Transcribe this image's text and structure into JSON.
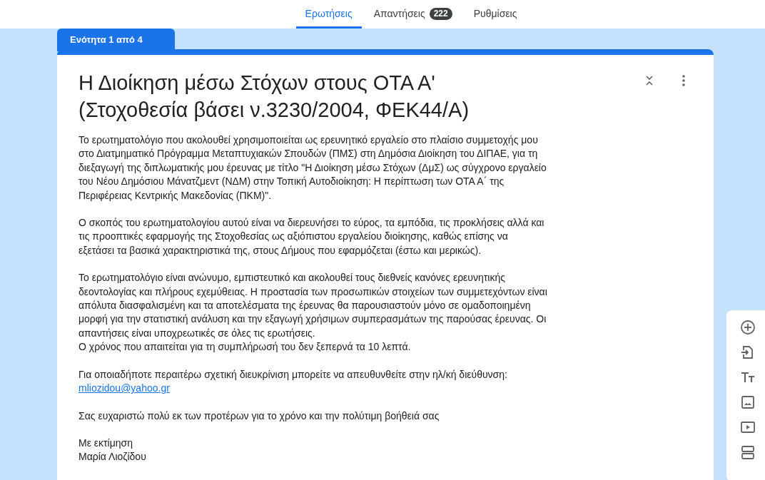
{
  "tabs": [
    {
      "label": "Ερωτήσεις",
      "selected": true
    },
    {
      "label": "Απαντήσεις",
      "selected": false,
      "badge": "222"
    },
    {
      "label": "Ρυθμίσεις",
      "selected": false
    }
  ],
  "section_tab": "Ενότητα 1 από 4",
  "form": {
    "title": "Η Διοίκηση μέσω Στόχων στους ΟΤΑ Α'\n(Στοχοθεσία βάσει ν.3230/2004, ΦΕΚ44/Α)",
    "paragraphs": [
      {
        "text": "Το ερωτηματολόγιο που ακολουθεί χρησιμοποιείται ως ερευνητικό εργαλείο στο πλαίσιο συμμετοχής μου\nστο Διατμηματικό Πρόγραμμα Μεταπτυχιακών Σπουδών (ΠΜΣ) στη Δημόσια Διοίκηση του ΔΙΠΑΕ, για τη\nδιεξαγωγή της διπλωματικής μου έρευνας με τίτλο \"Η Διοίκηση μέσω Στόχων (ΔμΣ) ως σύγχρονο εργαλείο\nτου Νέου Δημόσιου Μάνατζμεντ  (ΝΔΜ) στην Τοπική Αυτοδιοίκηση:  Η περίπτωση των ΟΤΑ Α΄ της\nΠεριφέρειας Κεντρικής Μακεδονίας (ΠΚΜ)\"."
      },
      {
        "text": "Ο σκοπός του ερωτηματολογίου αυτού είναι να διερευνήσει το εύρος, τα εμπόδια, τις προκλήσεις αλλά και\nτις προοπτικές εφαρμογής της Στοχοθεσίας ως αξιόπιστου εργαλείου διοίκησης, καθώς επίσης να\nεξετάσει τα βασικά χαρακτηριστικά της,  στους Δήμους που εφαρμόζεται (έστω και μερικώς)."
      },
      {
        "text": "Το ερωτηματολόγιο είναι ανώνυμο, εμπιστευτικό και ακολουθεί τους διεθνείς κανόνες ερευνητικής\nδεοντολογίας και πλήρους εχεμύθειας. Η προστασία των προσωπικών στοιχείων των συμμετεχόντων είναι\nαπόλυτα διασφαλισμένη και τα αποτελέσματα της έρευνας θα παρουσιαστούν μόνο σε ομαδοποιημένη\nμορφή για την στατιστική ανάλυση και την εξαγωγή χρήσιμων συμπερασμάτων της παρούσας έρευνας. Οι\nαπαντήσεις είναι υποχρεωτικές σε όλες τις ερωτήσεις.\nΟ χρόνος που απαιτείται για τη συμπλήρωσή του δεν ξεπερνά τα 10 λεπτά."
      },
      {
        "text": "Για οποιαδήποτε περαιτέρω σχετική διευκρίνιση μπορείτε να απευθυνθείτε στην ηλ/κή διεύθυνση:",
        "link": "mliozidou@yahoo.gr"
      },
      {
        "text": "Σας ευχαριστώ πολύ εκ των προτέρων για το χρόνο και την πολύτιμη βοήθειά σας"
      },
      {
        "text": "Με εκτίμηση\nΜαρία Λιοζίδου"
      }
    ]
  }
}
